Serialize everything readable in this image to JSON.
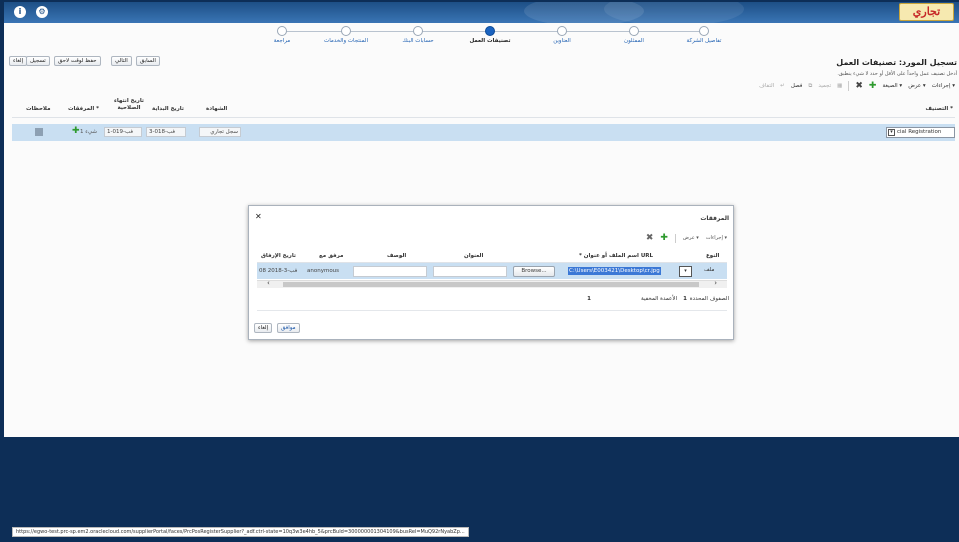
{
  "header": {
    "logo_text": "تجاري",
    "home_icon": "info-icon",
    "help_icon": "gear-icon"
  },
  "train": {
    "steps": [
      {
        "label": "تفاصيل الشركة",
        "active": false
      },
      {
        "label": "الممثلون",
        "active": false
      },
      {
        "label": "العناوين",
        "active": false
      },
      {
        "label": "تصنيفات العمل",
        "active": true
      },
      {
        "label": "حسابات البنك",
        "active": false
      },
      {
        "label": "المنتجات والخدمات",
        "active": false
      },
      {
        "label": "مراجعة",
        "active": false
      }
    ]
  },
  "actions": {
    "back": "السابق",
    "next": "التالي",
    "save_later": "حفظ لوقت لاحق",
    "register": "تسجيل",
    "cancel": "إلغاء"
  },
  "page": {
    "title": "تسجيل المورد: تصنيفات العمل",
    "description": "أدخل تصنيف عمل واحداً على الأقل أو حدد لا شيء ينطبق."
  },
  "toolbar": {
    "actions": "إجراءات",
    "view": "عرض",
    "format": "الصيغة",
    "freeze": "تجميد",
    "detach": "فصل",
    "wrap": "التفاف"
  },
  "table": {
    "headers": {
      "classification": "* التصنيف",
      "certificate": "الشهادة",
      "start_date": "تاريخ البداية",
      "end_date": "تاريخ انتهاء الصلاحية",
      "attachments": "* المرفقات",
      "notes": "ملاحظات"
    },
    "row": {
      "classification": "cial Registration",
      "certificate": "سجل تجاري",
      "start_date": "3-فب-018",
      "end_date": "1-فب-019",
      "attachments": "1 شيء"
    }
  },
  "dialog": {
    "title": "المرفقات",
    "actions": "إجراءات",
    "view": "عرض",
    "headers": {
      "type": "النوع",
      "file_url": "* اسم الملف أو عنوان URL",
      "title": "العنوان",
      "description": "الوصف",
      "attached_by": "مرفق مع",
      "attached_date": "تاريخ الإرفاق"
    },
    "row": {
      "type": "ملف",
      "browse": "Browse...",
      "path": "C:\\Users\\E003421\\Desktop\\cr.jpg",
      "attached_by": "anonymous",
      "attached_date": "08 2018-فب-3"
    },
    "footer": {
      "selected_label": "الصفوف المحددة",
      "selected_value": "1",
      "frozen_label": "الأعمدة المخفية",
      "frozen_value": "1"
    },
    "ok": "موافق",
    "cancel": "إلغاء"
  },
  "status_url": "https://egwo-test.prc-sp.em2.oraclecloud.com/supplierPortal/faces/PrcPosRegisterSupplier?_adf.ctrl-state=10q3w3e4hb_5&prcBuId=300000001304109&busRel=MuQ92rNyabZp..."
}
